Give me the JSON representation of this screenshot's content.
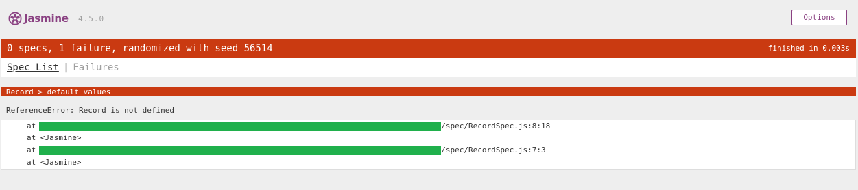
{
  "header": {
    "app_name": "Jasmine",
    "version": "4.5.0",
    "options_label": "Options"
  },
  "summary": {
    "text": "0 specs, 1 failure, randomized with seed 56514",
    "duration": "finished in 0.003s"
  },
  "menu": {
    "spec_list_label": "Spec List",
    "separator": "|",
    "failures_label": "Failures"
  },
  "failure": {
    "spec_name": "Record > default values",
    "message": "ReferenceError: Record is not defined",
    "stack": [
      {
        "prefix": "at",
        "redacted": true,
        "location": "/spec/RecordSpec.js:8:18"
      },
      {
        "prefix": "at",
        "text": "<Jasmine>"
      },
      {
        "prefix": "at",
        "redacted": true,
        "location": "/spec/RecordSpec.js:7:3"
      },
      {
        "prefix": "at",
        "text": "<Jasmine>"
      }
    ]
  },
  "colors": {
    "brand": "#8a4182",
    "failure": "#ca3a11",
    "redaction": "#20b04c"
  }
}
